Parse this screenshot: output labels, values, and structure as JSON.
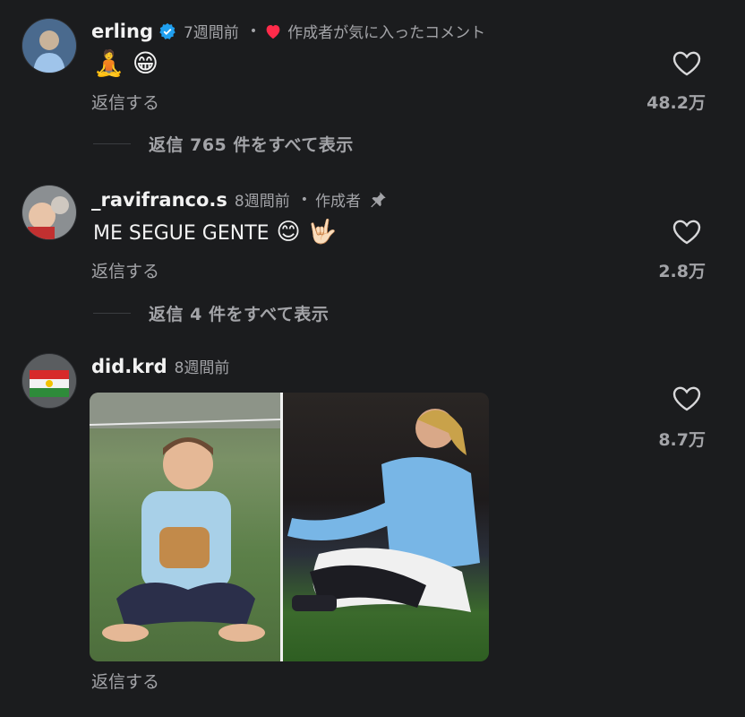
{
  "comments": [
    {
      "username": "erling",
      "verified": true,
      "time": "7週間前",
      "separator": "•",
      "creator_liked_label": "作成者が気に入ったコメント",
      "text": "🧘 😁",
      "reply_label": "返信する",
      "view_replies": "返信 765 件をすべて表示",
      "likes": "48.2万"
    },
    {
      "username": "_ravifranco.s",
      "time": "8週間前",
      "separator": "•",
      "author_label": "作成者",
      "text": "ME SEGUE GENTE",
      "emoji": "😊 🤟🏻",
      "reply_label": "返信する",
      "view_replies": "返信 4 件をすべて表示",
      "likes": "2.8万"
    },
    {
      "username": "did.krd",
      "time": "8週間前",
      "reply_label": "返信する",
      "likes": "8.7万"
    }
  ],
  "colors": {
    "background": "#1b1c1e",
    "secondary_text": "#a3a4a8",
    "verified_blue": "#20a0f0",
    "creator_heart": "#ff2b4a"
  },
  "icons": [
    "verified-badge-icon",
    "heart-icon",
    "pin-icon",
    "like-heart-outline-icon"
  ]
}
